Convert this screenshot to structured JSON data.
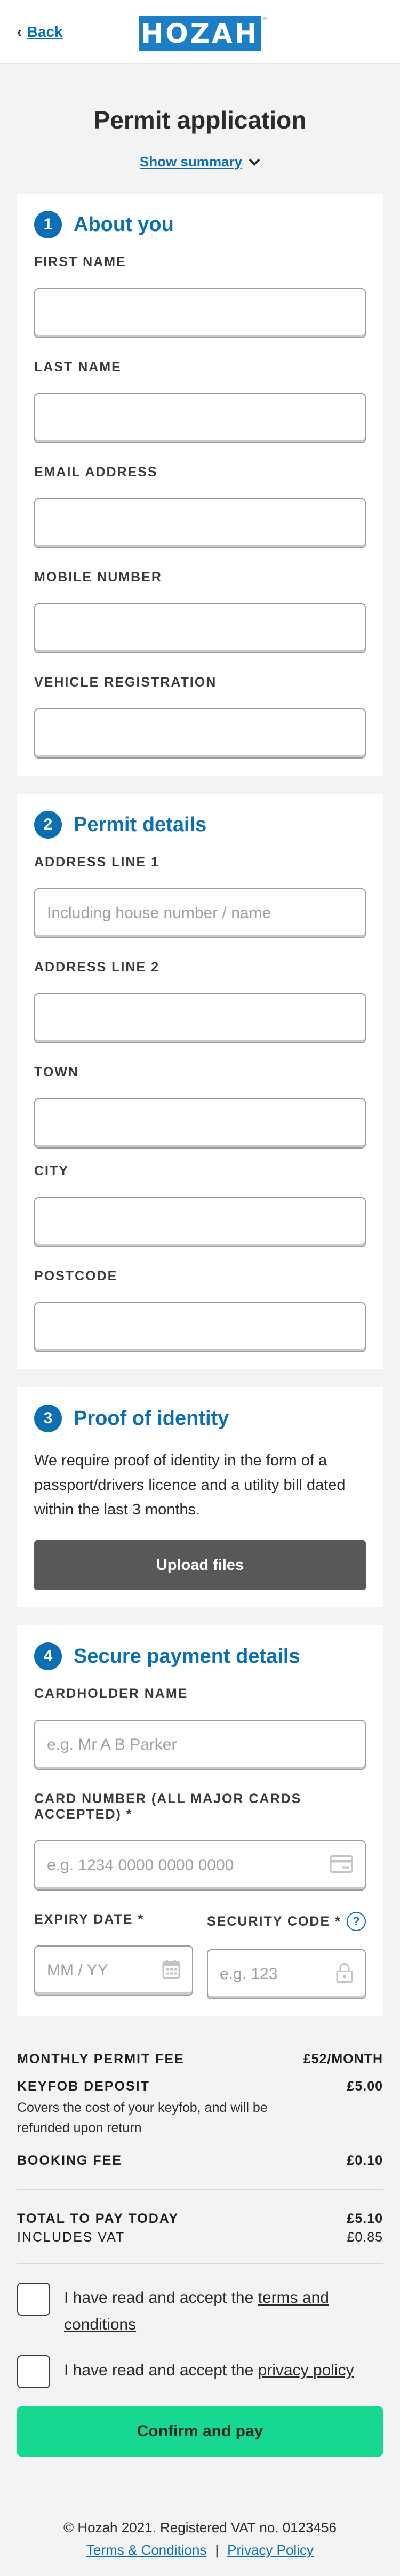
{
  "header": {
    "back_label": "Back",
    "logo_text": "HOZAH",
    "logo_mark": "®"
  },
  "page": {
    "title": "Permit application",
    "summary_toggle": "Show summary"
  },
  "section1": {
    "number": "1",
    "title": "About you",
    "fields": {
      "first_name": {
        "label": "FIRST NAME",
        "value": "",
        "placeholder": ""
      },
      "last_name": {
        "label": "LAST NAME",
        "value": "",
        "placeholder": ""
      },
      "email": {
        "label": "EMAIL ADDRESS",
        "value": "",
        "placeholder": ""
      },
      "mobile": {
        "label": "MOBILE NUMBER",
        "value": "",
        "placeholder": ""
      },
      "vehicle": {
        "label": "VEHICLE REGISTRATION",
        "value": "",
        "placeholder": ""
      }
    }
  },
  "section2": {
    "number": "2",
    "title": "Permit details",
    "fields": {
      "address1": {
        "label": "ADDRESS LINE 1",
        "value": "",
        "placeholder": "Including house number / name"
      },
      "address2": {
        "label": "ADDRESS LINE 2",
        "value": "",
        "placeholder": ""
      },
      "town": {
        "label": "TOWN",
        "value": "",
        "placeholder": ""
      },
      "city": {
        "label": "CITY",
        "value": "",
        "placeholder": ""
      },
      "postcode": {
        "label": "POSTCODE",
        "value": "",
        "placeholder": ""
      }
    }
  },
  "section3": {
    "number": "3",
    "title": "Proof of identity",
    "description": "We require proof of identity in the form of a passport/drivers licence and a utility bill dated within the last 3 months.",
    "upload_label": "Upload files"
  },
  "section4": {
    "number": "4",
    "title": "Secure payment details",
    "fields": {
      "cardholder": {
        "label": "CARDHOLDER NAME",
        "value": "",
        "placeholder": "e.g. Mr A B Parker"
      },
      "card_number": {
        "label": "CARD NUMBER (ALL MAJOR CARDS ACCEPTED) *",
        "value": "",
        "placeholder": "e.g. 1234 0000 0000 0000"
      },
      "expiry": {
        "label": "EXPIRY DATE *",
        "value": "",
        "placeholder": "MM / YY"
      },
      "security": {
        "label": "SECURITY CODE *",
        "value": "",
        "placeholder": "e.g. 123"
      }
    },
    "help_glyph": "?"
  },
  "fees": {
    "monthly": {
      "name": "MONTHLY PERMIT FEE",
      "value": "£52/MONTH"
    },
    "keyfob": {
      "name": "KEYFOB DEPOSIT",
      "value": "£5.00",
      "note": "Covers the cost of your keyfob, and will be refunded upon return"
    },
    "booking": {
      "name": "BOOKING FEE",
      "value": "£0.10"
    },
    "total": {
      "name": "TOTAL TO PAY TODAY",
      "value": "£5.10"
    },
    "vat": {
      "name": "INCLUDES VAT",
      "value": "£0.85"
    }
  },
  "consents": {
    "terms": {
      "prefix": "I have read and accept the ",
      "link": "terms and conditions",
      "checked": false
    },
    "privacy": {
      "prefix": "I have read and accept the ",
      "link": "privacy policy",
      "checked": false
    }
  },
  "actions": {
    "confirm_label": "Confirm and pay"
  },
  "footer": {
    "copyright": "© Hozah 2021. Registered VAT no. 0123456",
    "terms_link": "Terms & Conditions",
    "separator": "|",
    "privacy_link": "Privacy Policy"
  },
  "colors": {
    "brand": "#1a7fc6",
    "accent_blue": "#0a6fb5",
    "confirm_green": "#16d890",
    "upload_grey": "#585858",
    "page_bg": "#f3f3f3"
  },
  "icons": {
    "back": "chevron-left-icon",
    "summary": "chevron-down-icon",
    "card": "credit-card-icon",
    "calendar": "calendar-icon",
    "lock": "lock-icon",
    "help": "help-icon"
  }
}
